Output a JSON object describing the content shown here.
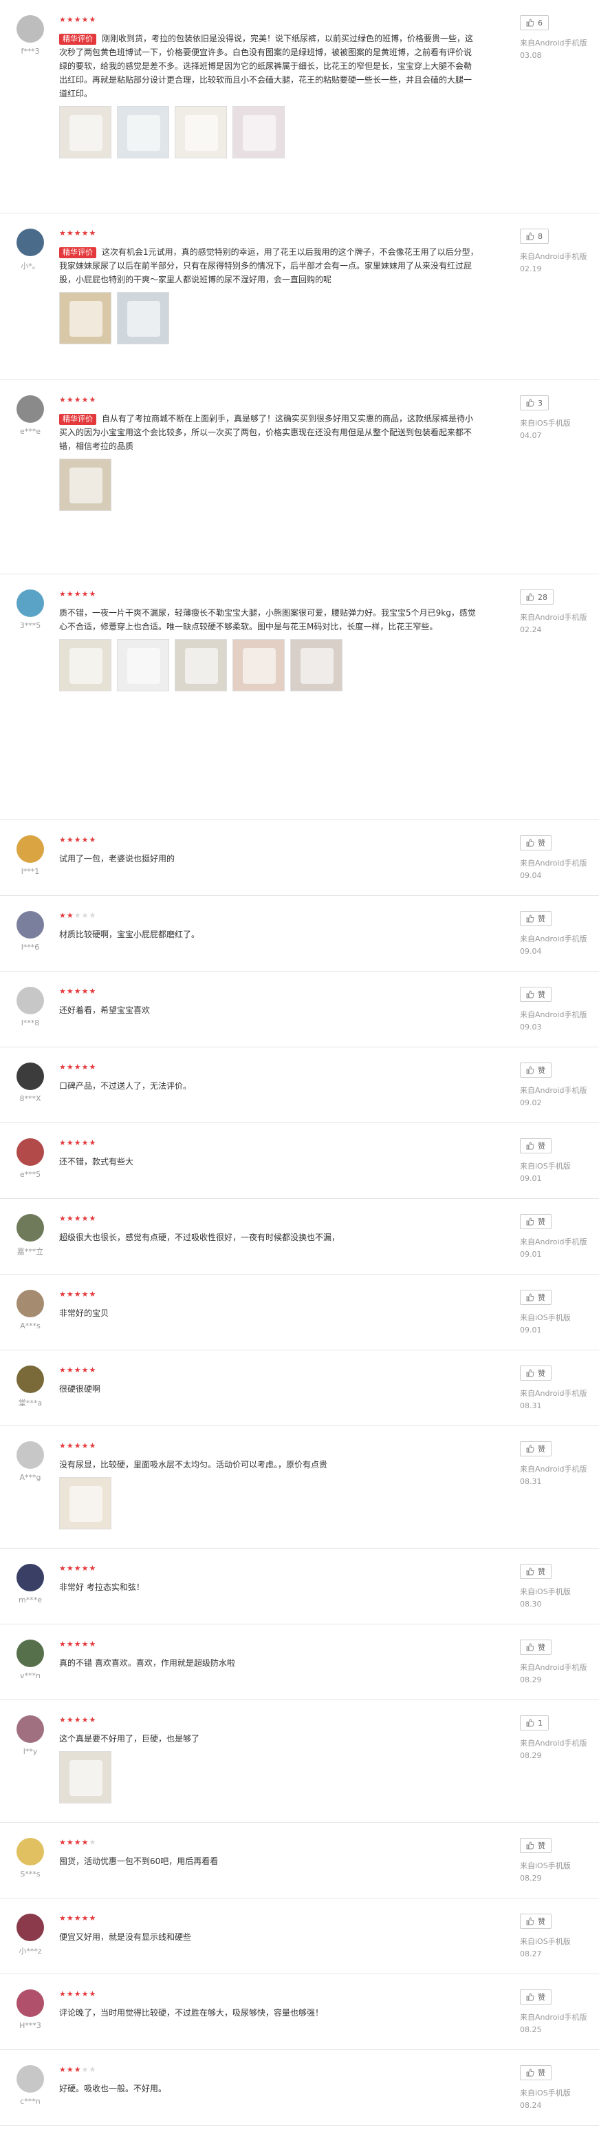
{
  "colors": {
    "star": "#e4393c",
    "star_off": "#d9d9d9",
    "badge": "#e4393c",
    "muted": "#999999"
  },
  "reviews": [
    {
      "user": "f***3",
      "stars": 5,
      "badge": "精华评价",
      "text": "刚刚收到货，考拉的包装依旧是没得说，完美！说下纸尿裤，以前买过绿色的班博，价格要贵一些，这次秒了两包黄色班博试一下，价格要便宜许多。白色没有图案的是绿班博，被被图案的是黄班博，之前看有评价说绿的要软，给我的感觉是差不多。选择班博是因为它的纸尿裤属于细长，比花王的窄但是长，宝宝穿上大腿不会勒出红印。再就是粘贴部分设计更合理，比较软而且小不会磕大腿，花王的粘贴要硬一些长一些，并且会磕的大腿一道红印。",
      "likes": "6",
      "device": "来自Android手机版",
      "date": "03.08",
      "avatar_color": "#bdbdbd",
      "photos": [
        "#e9e4dc",
        "#dfe5e8",
        "#f0ede6",
        "#e8dfe3"
      ]
    },
    {
      "user": "小*。",
      "stars": 5,
      "badge": "精华评价",
      "text": "这次有机会1元试用，真的感觉特别的幸运，用了花王以后我用的这个牌子，不会像花王用了以后分型，我家妹妹尿尿了以后在前半部分，只有在尿得特别多的情况下，后半部才会有一点。家里妹妹用了从来没有红过屁股，小屁屁也特别的干爽～家里人都说班博的尿不湿好用，会一直回购的呢",
      "likes": "8",
      "device": "来自Android手机版",
      "date": "02.19",
      "avatar_color": "#4a6b8a",
      "photos": [
        "#d9c8a8",
        "#cfd6dc"
      ]
    },
    {
      "user": "e***e",
      "stars": 5,
      "badge": "精华评价",
      "text": "自从有了考拉商城不断在上面剁手，真是够了！这确实买到很多好用又实惠的商品，这款纸尿裤是待小买入的因为小宝宝用这个会比较多，所以一次买了两包，价格实惠现在还没有用但是从整个配送到包装看起来都不错，相信考拉的品质",
      "likes": "3",
      "device": "来自iOS手机版",
      "date": "04.07",
      "avatar_color": "#8a8a8a",
      "photos": [
        "#d6ccb8"
      ]
    },
    {
      "user": "3***5",
      "stars": 5,
      "badge": "",
      "text": "质不错，一夜一片干爽不漏尿，轻薄瘦长不勒宝宝大腿，小熊图案很可爱，腰贴弹力好。我宝宝5个月已9kg，感觉心不合适，修薏穿上也合适。唯一缺点较硬不够柔软。图中是与花王M码对比，长度一样，比花王窄些。",
      "likes": "28",
      "device": "来自Android手机版",
      "date": "02.24",
      "avatar_color": "#5ba3c6",
      "photos": [
        "#e6e1d5",
        "#eeeeee",
        "#dcd7cd",
        "#e3cfc4",
        "#d8d0c8"
      ]
    },
    {
      "user": "l***1",
      "stars": 5,
      "badge": "",
      "text": "试用了一包，老婆说也挺好用的",
      "likes": "赞",
      "device": "来自Android手机版",
      "date": "09.04",
      "avatar_color": "#d9a441",
      "photos": []
    },
    {
      "user": "l***6",
      "stars": 2,
      "badge": "",
      "text": "材质比较硬啊，宝宝小屁屁都磨红了。",
      "likes": "赞",
      "device": "来自Android手机版",
      "date": "09.04",
      "avatar_color": "#7b7f9e",
      "photos": []
    },
    {
      "user": "l***8",
      "stars": 5,
      "badge": "",
      "text": "还好着看，希望宝宝喜欢",
      "likes": "赞",
      "device": "来自Android手机版",
      "date": "09.03",
      "avatar_color": "#c7c7c7",
      "photos": []
    },
    {
      "user": "8***X",
      "stars": 5,
      "badge": "",
      "text": "口碑产品，不过送人了，无法评价。",
      "likes": "赞",
      "device": "来自Android手机版",
      "date": "09.02",
      "avatar_color": "#3c3c3c",
      "photos": []
    },
    {
      "user": "e***5",
      "stars": 5,
      "badge": "",
      "text": "还不错，款式有些大",
      "likes": "赞",
      "device": "来自iOS手机版",
      "date": "09.01",
      "avatar_color": "#b34a4a",
      "photos": []
    },
    {
      "user": "嘉***立",
      "stars": 5,
      "badge": "",
      "text": "超级很大也很长，感觉有点硬，不过吸收性很好，一夜有时候都没换也不漏，",
      "likes": "赞",
      "device": "来自Android手机版",
      "date": "09.01",
      "avatar_color": "#6e7a5a",
      "photos": []
    },
    {
      "user": "A***s",
      "stars": 5,
      "badge": "",
      "text": "非常好的宝贝",
      "likes": "赞",
      "device": "来自iOS手机版",
      "date": "09.01",
      "avatar_color": "#a58b6f",
      "photos": []
    },
    {
      "user": "堂***a",
      "stars": 5,
      "badge": "",
      "text": "很硬很硬啊",
      "likes": "赞",
      "device": "来自Android手机版",
      "date": "08.31",
      "avatar_color": "#7a6a3a",
      "photos": []
    },
    {
      "user": "A***g",
      "stars": 5,
      "badge": "",
      "text": "没有尿显，比较硬，里面吸水层不太均匀。活动价可以考虑。，原价有点贵",
      "likes": "赞",
      "device": "来自Android手机版",
      "date": "08.31",
      "avatar_color": "#c7c7c7",
      "photos": [
        "#ece4d6"
      ]
    },
    {
      "user": "m***e",
      "stars": 5,
      "badge": "",
      "text": "非常好 考拉态实和弦！",
      "likes": "赞",
      "device": "来自iOS手机版",
      "date": "08.30",
      "avatar_color": "#3a3f66",
      "photos": []
    },
    {
      "user": "v***n",
      "stars": 5,
      "badge": "",
      "text": "真的不错 喜欢喜欢。喜欢，作用就是超级防水啦",
      "likes": "赞",
      "device": "来自Android手机版",
      "date": "08.29",
      "avatar_color": "#55704a",
      "photos": []
    },
    {
      "user": "l**y",
      "stars": 5,
      "badge": "",
      "text": "这个真是要不好用了，巨硬，也是够了",
      "likes": "1",
      "device": "来自Android手机版",
      "date": "08.29",
      "avatar_color": "#a07080",
      "photos": [
        "#e5e0d6"
      ]
    },
    {
      "user": "S***s",
      "stars": 4,
      "badge": "",
      "text": "囤货，活动优惠一包不到60吧，用后再看看",
      "likes": "赞",
      "device": "来自iOS手机版",
      "date": "08.29",
      "avatar_color": "#e0c060",
      "photos": []
    },
    {
      "user": "小***z",
      "stars": 5,
      "badge": "",
      "text": "便宜又好用，就是没有显示线和硬些",
      "likes": "赞",
      "device": "来自iOS手机版",
      "date": "08.27",
      "avatar_color": "#8a3a4a",
      "photos": []
    },
    {
      "user": "H***3",
      "stars": 5,
      "badge": "",
      "text": "评论晚了，当时用觉得比较硬，不过胜在够大，吸尿够快，容量也够强！",
      "likes": "赞",
      "device": "来自Android手机版",
      "date": "08.25",
      "avatar_color": "#b0506a",
      "photos": []
    },
    {
      "user": "c***n",
      "stars": 3,
      "badge": "",
      "text": "好硬。吸收也一般。不好用。",
      "likes": "赞",
      "device": "来自iOS手机版",
      "date": "08.24",
      "avatar_color": "#c7c7c7",
      "photos": []
    }
  ]
}
